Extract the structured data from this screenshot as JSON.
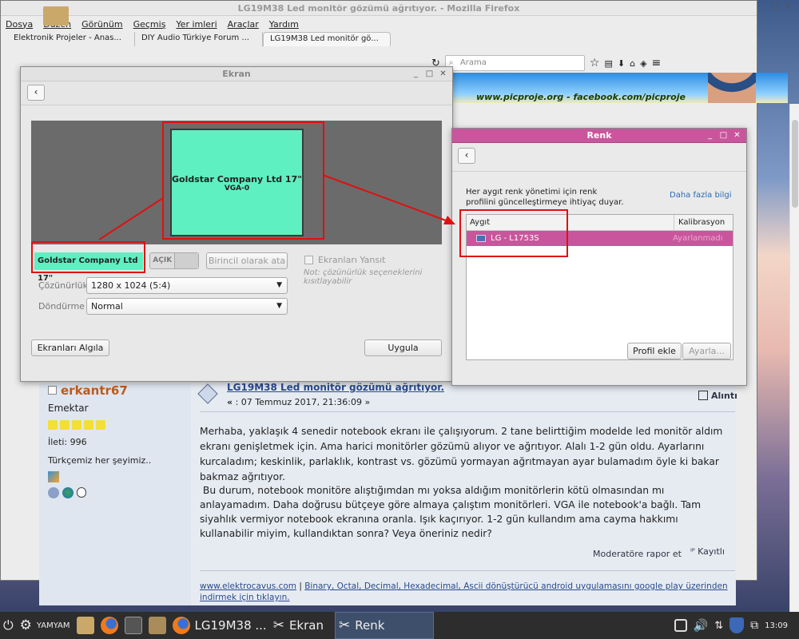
{
  "desktop": {
    "folder_icon": "folder-icon"
  },
  "firefox": {
    "title": "LG19M38 Led monitör gözümü ağrıtıyor. - Mozilla Firefox",
    "menu": [
      "Dosya",
      "Düzen",
      "Görünüm",
      "Geçmiş",
      "Yer imleri",
      "Araçlar",
      "Yardım"
    ],
    "tabs": [
      "Elektronik Projeler - Anas...",
      "DIY Audio Türkiye Forum ...",
      "LG19M38 Led monitör gö..."
    ],
    "search_placeholder": "Arama",
    "banner_text": "www.picproje.org - facebook.com/picproje"
  },
  "post": {
    "username": "erkantr67",
    "rank": "Emektar",
    "posts_label": "İleti: 996",
    "signature_line": "Türkçemiz her şeyimiz..",
    "title": "LG19M38 Led monitör gözümü ağrıtıyor.",
    "date_prefix": "«",
    "date": " : 07 Temmuz 2017, 21:36:09 »",
    "quote_label": "Alıntı",
    "p1": "Merhaba, yaklaşık 4 senedir notebook ekranı ile çalışıyorum. 2 tane belirttiğim modelde led monitör aldım ekranı genişletmek için. Ama harici monitörler gözümü alıyor ve ağrıtıyor. Alalı 1-2 gün oldu. Ayarlarını kurcaladım; keskinlik, parlaklık, kontrast vs. gözümü yormayan ağrıtmayan ayar bulamadım öyle ki bakar bakmaz ağrıtıyor.",
    "p2": " Bu durum, notebook monitöre alıştığımdan mı yoksa aldığım monitörlerin kötü olmasından mı anlayamadım. Daha doğrusu bütçeye göre almaya çalıştım monitörleri. VGA ile notebook'a bağlı. Tam siyahlık vermiyor notebook ekranına oranla. Işık kaçırıyor. 1-2 gün kullandım ama cayma hakkımı kullanabilir miyim, kullandıktan sonra? Veya öneriniz nedir?",
    "report": "Moderatöre rapor et",
    "logged": "Kayıtlı",
    "sig_link": "www.elektrocavus.com",
    "sig_sep": " | ",
    "sig_text": "Binary, Octal, Decimal, Hexadecimal, Ascii dönüştürücü android uygulamasını google play üzerinden indirmek için tıklayın."
  },
  "ekran": {
    "title": "Ekran",
    "monitor_name": "Goldstar Company Ltd 17\"",
    "monitor_port": "VGA-0",
    "label_box": "Goldstar Company Ltd 17\"",
    "toggle": "AÇIK",
    "primary_btn": "Birincil olarak ata",
    "mirror": "Ekranları Yansıt",
    "note": "Not: çözünürlük seçeneklerini kısıtlayabilir",
    "res_label": "Çözünürlük",
    "res_value": "1280 x 1024 (5:4)",
    "rot_label": "Döndürme",
    "rot_value": "Normal",
    "detect_btn": "Ekranları Algıla",
    "apply_btn": "Uygula"
  },
  "renk": {
    "title": "Renk",
    "info": "Her aygıt renk yönetimi için renk profilini güncelleştirmeye ihtiyaç duyar.",
    "more": "Daha fazla bilgi",
    "col_device": "Aygıt",
    "col_calib": "Kalibrasyon",
    "device": "LG - L1753S",
    "device_status": "Ayarlanmadı",
    "add_profile": "Profil ekle",
    "adjust": "Ayarla..."
  },
  "taskbar": {
    "user": "YAMYAM",
    "firefox_task": "LG19M38 ...",
    "ekran_task": "Ekran",
    "renk_task": "Renk",
    "clock": "13:09"
  }
}
